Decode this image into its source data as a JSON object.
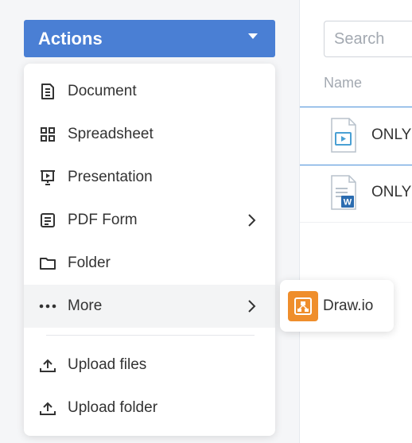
{
  "actions": {
    "label": "Actions"
  },
  "menu": {
    "items": [
      {
        "label": "Document"
      },
      {
        "label": "Spreadsheet"
      },
      {
        "label": "Presentation"
      },
      {
        "label": "PDF Form"
      },
      {
        "label": "Folder"
      },
      {
        "label": "More"
      },
      {
        "label": "Upload files"
      },
      {
        "label": "Upload folder"
      }
    ]
  },
  "submenu": {
    "label": "Draw.io"
  },
  "search": {
    "placeholder": "Search"
  },
  "table": {
    "header": "Name",
    "rows": [
      {
        "name": "ONLY",
        "icon": "presentation-file-icon"
      },
      {
        "name": "ONLY",
        "icon": "word-document-file-icon"
      }
    ]
  },
  "colors": {
    "accent": "#4a7fd4",
    "drawio": "#ef8e2c",
    "row_line": "#4a90d9"
  }
}
